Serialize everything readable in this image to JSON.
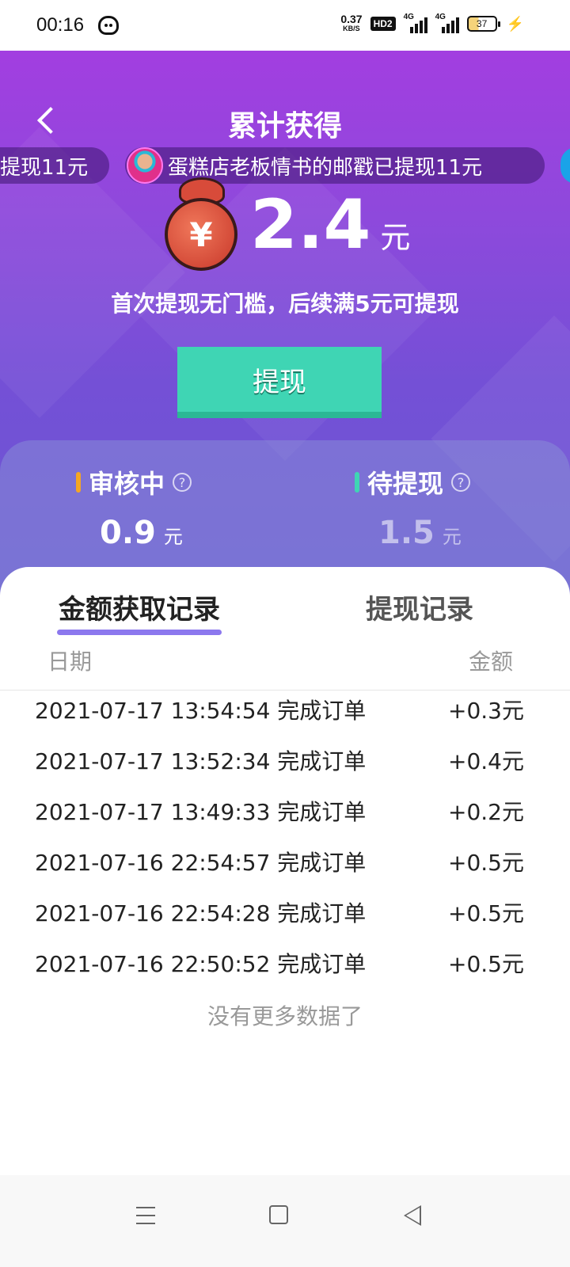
{
  "status_bar": {
    "time": "00:16",
    "net_speed": "0.37",
    "net_unit": "KB/S",
    "hd_badge": "HD2",
    "signal1_label": "4G",
    "signal2_label": "4G",
    "battery": "37"
  },
  "header": {
    "title": "累计获得"
  },
  "ticker": {
    "left_text": "提现11元",
    "main_text": "蛋糕店老板情书的邮戳已提现11元"
  },
  "balance": {
    "currency_symbol": "¥",
    "amount": "2.4",
    "unit": "元",
    "hint": "首次提现无门槛，后续满5元可提现",
    "withdraw_label": "提现"
  },
  "stats": {
    "reviewing": {
      "label": "审核中",
      "value": "0.9",
      "unit": "元",
      "accent": "#f5a623"
    },
    "pending": {
      "label": "待提现",
      "value": "1.5",
      "unit": "元",
      "accent": "#3fd5b4"
    }
  },
  "records": {
    "tabs": [
      "金额获取记录",
      "提现记录"
    ],
    "columns": {
      "date": "日期",
      "amount": "金额"
    },
    "rows": [
      {
        "desc": "2021-07-17 13:54:54 完成订单",
        "amount": "+0.3元"
      },
      {
        "desc": "2021-07-17 13:52:34 完成订单",
        "amount": "+0.4元"
      },
      {
        "desc": "2021-07-17 13:49:33 完成订单",
        "amount": "+0.2元"
      },
      {
        "desc": "2021-07-16 22:54:57 完成订单",
        "amount": "+0.5元"
      },
      {
        "desc": "2021-07-16 22:54:28 完成订单",
        "amount": "+0.5元"
      },
      {
        "desc": "2021-07-16 22:50:52 完成订单",
        "amount": "+0.5元"
      }
    ],
    "no_more": "没有更多数据了"
  }
}
